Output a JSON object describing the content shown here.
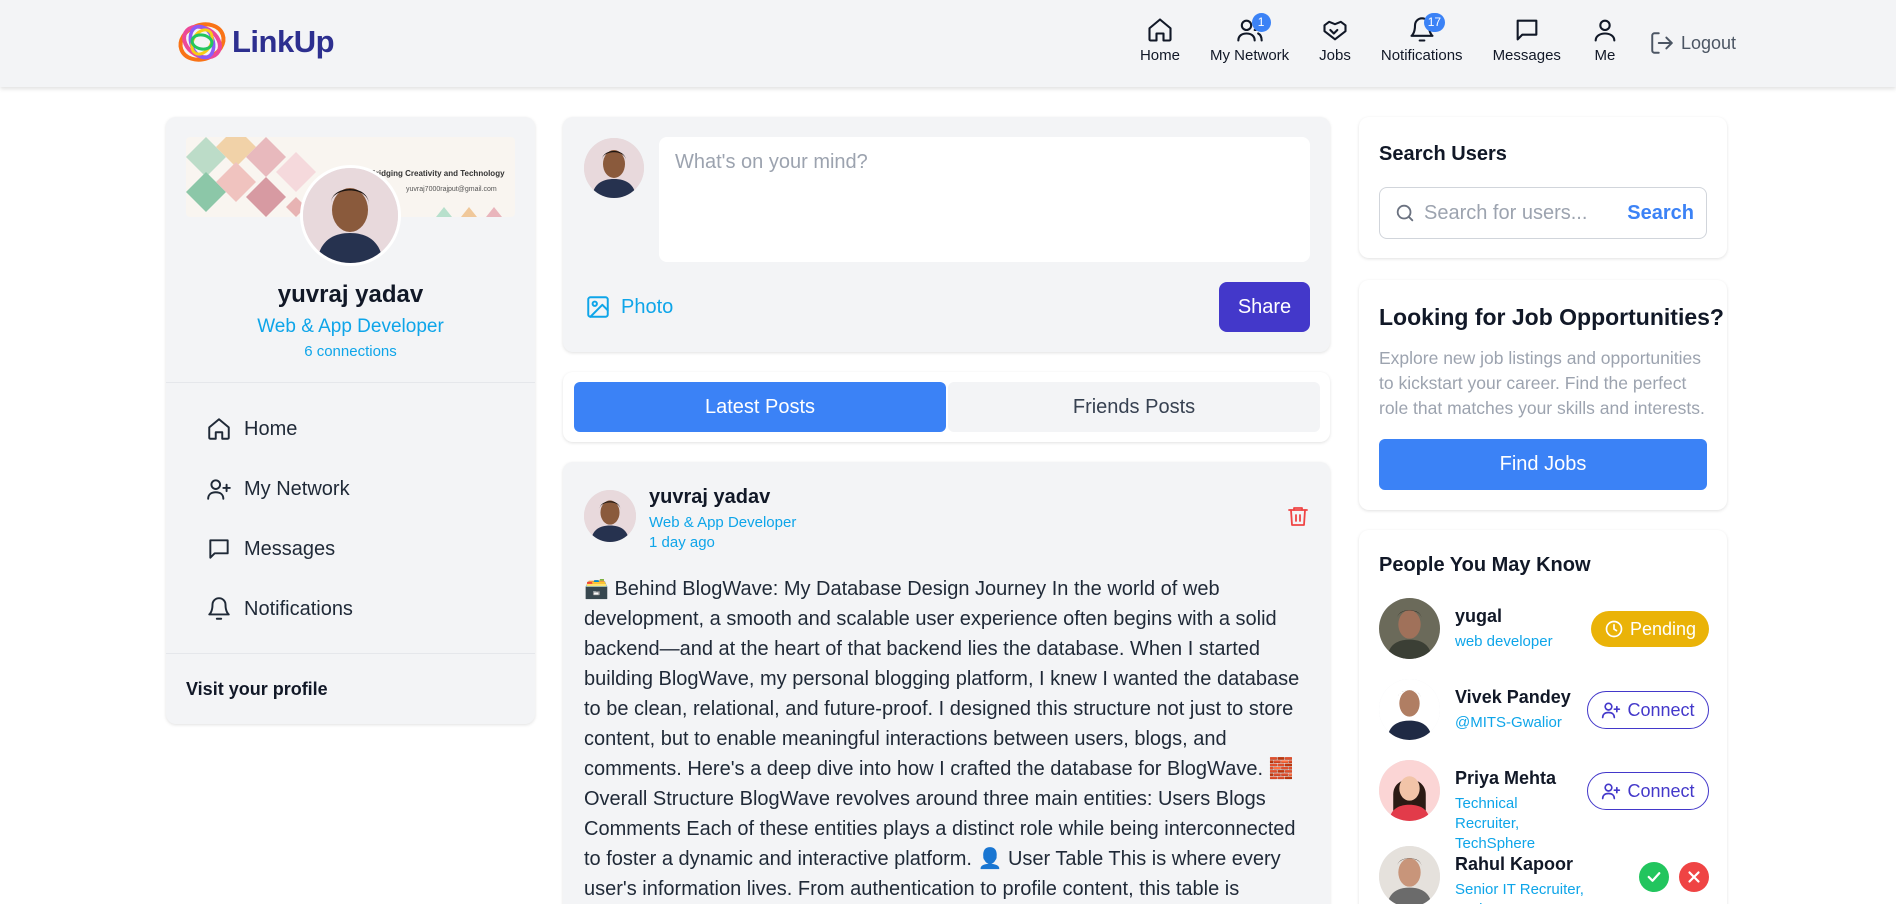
{
  "app": {
    "name": "LinkUp"
  },
  "nav": {
    "items": [
      {
        "label": "Home",
        "icon": "home-icon",
        "badge": ""
      },
      {
        "label": "My Network",
        "icon": "network-icon",
        "badge": "1"
      },
      {
        "label": "Jobs",
        "icon": "handshake-icon",
        "badge": ""
      },
      {
        "label": "Notifications",
        "icon": "bell-icon",
        "badge": "17"
      },
      {
        "label": "Messages",
        "icon": "message-icon",
        "badge": ""
      },
      {
        "label": "Me",
        "icon": "user-icon",
        "badge": ""
      }
    ],
    "logout": "Logout"
  },
  "profile": {
    "name": "yuvraj yadav",
    "title": "Web & App Developer",
    "connections": "6 connections",
    "banner_text": "Bridging Creativity and Technology",
    "banner_email": "yuvraj7000rajput@gmail.com",
    "menu": [
      "Home",
      "My Network",
      "Messages",
      "Notifications"
    ],
    "visit": "Visit your profile"
  },
  "composer": {
    "placeholder": "What's on your mind?",
    "photo_label": "Photo",
    "share_label": "Share"
  },
  "tabs": {
    "latest": "Latest Posts",
    "friends": "Friends Posts"
  },
  "post": {
    "author": "yuvraj yadav",
    "role": "Web & App Developer",
    "time": "1 day ago",
    "body": "🗃️ Behind BlogWave: My Database Design Journey In the world of web development, a smooth and scalable user experience often begins with a solid backend—and at the heart of that backend lies the database. When I started building BlogWave, my personal blogging platform, I knew I wanted the database to be clean, relational, and future-proof. I designed this structure not just to store content, but to enable meaningful interactions between users, blogs, and comments. Here's a deep dive into how I crafted the database for BlogWave. 🧱 Overall Structure BlogWave revolves around three main entities: Users Blogs Comments Each of these entities plays a distinct role while being interconnected to foster a dynamic and interactive platform. 👤 User Table This is where every user's information lives. From authentication to profile content, this table is"
  },
  "search": {
    "title": "Search Users",
    "placeholder": "Search for users...",
    "button": "Search"
  },
  "jobs": {
    "title": "Looking for Job Opportunities?",
    "description": "Explore new job listings and opportunities to kickstart your career. Find the perfect role that matches your skills and interests.",
    "button": "Find Jobs"
  },
  "pymk": {
    "title": "People You May Know",
    "people": [
      {
        "name": "yugal",
        "role": "web developer",
        "action": "Pending"
      },
      {
        "name": "Vivek Pandey",
        "role": "@MITS-Gwalior",
        "action": "Connect"
      },
      {
        "name": "Priya Mehta",
        "role": "Technical Recruiter, TechSphere",
        "action": "Connect"
      },
      {
        "name": "Rahul Kapoor",
        "role": "Senior IT Recruiter, CodeNest",
        "action": "accept-reject"
      }
    ]
  },
  "colors": {
    "primary": "#3b82f6",
    "indigo": "#4338ca",
    "accent_text": "#0ea5e9",
    "pending": "#eab308",
    "accept": "#22c55e",
    "reject": "#ef4444"
  }
}
